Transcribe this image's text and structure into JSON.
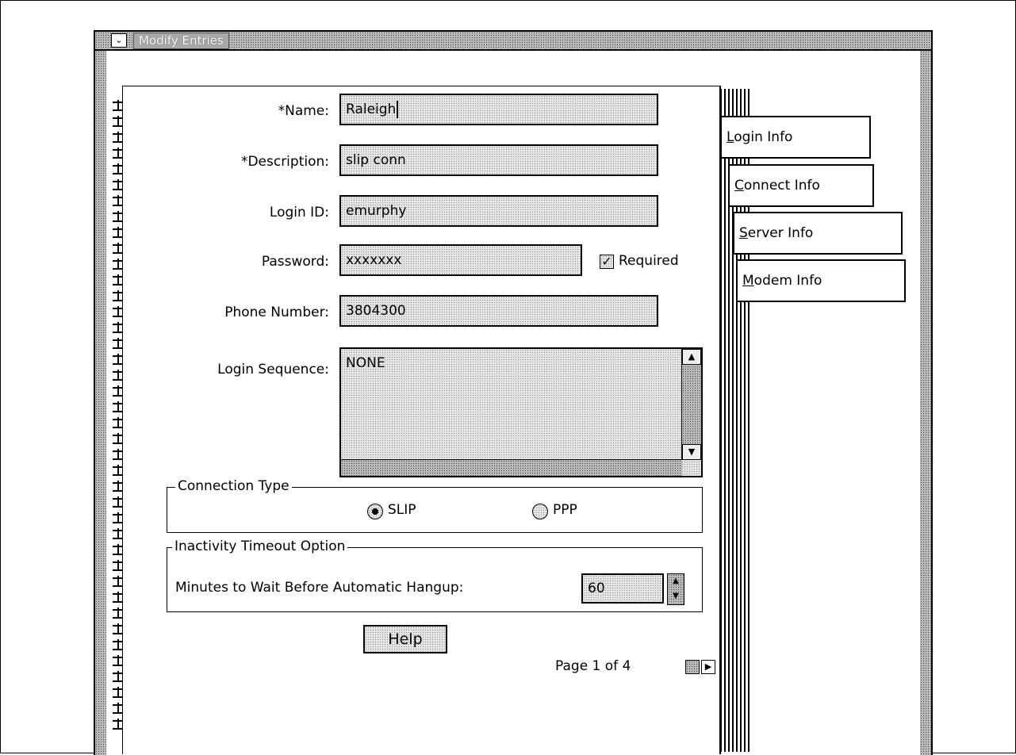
{
  "window": {
    "title": "Modify Entries",
    "system_menu_glyph": "⌄"
  },
  "form": {
    "name_label": "*Name:",
    "name_value": "Raleigh",
    "description_label": "*Description:",
    "description_value": "slip conn",
    "login_id_label": "Login ID:",
    "login_id_value": "emurphy",
    "password_label": "Password:",
    "password_value": "xxxxxxx",
    "required_label": "Required",
    "required_checked": true,
    "phone_label": "Phone Number:",
    "phone_value": "3804300",
    "login_sequence_label": "Login Sequence:",
    "login_sequence_value": "NONE"
  },
  "connection_type": {
    "title": "Connection Type",
    "options": [
      {
        "label": "SLIP",
        "selected": true
      },
      {
        "label": "PPP",
        "selected": false
      }
    ]
  },
  "inactivity": {
    "title": "Inactivity Timeout Option",
    "label": "Minutes to Wait Before Automatic Hangup:",
    "value": "60"
  },
  "help_label": "Help",
  "pagination": {
    "text": "Page 1 of 4",
    "current": 1,
    "total": 4
  },
  "tabs": [
    {
      "mnemonic": "L",
      "rest": "ogin Info",
      "active": true
    },
    {
      "mnemonic": "C",
      "rest": "onnect Info",
      "active": false
    },
    {
      "mnemonic": "S",
      "rest": "erver Info",
      "active": false
    },
    {
      "mnemonic": "M",
      "rest": "odem Info",
      "active": false
    }
  ],
  "icons": {
    "checkbox_check": "✓",
    "scroll_up": "▲",
    "scroll_down": "▼",
    "spin_up": "▲",
    "spin_down": "▼",
    "page_next": "▶"
  }
}
